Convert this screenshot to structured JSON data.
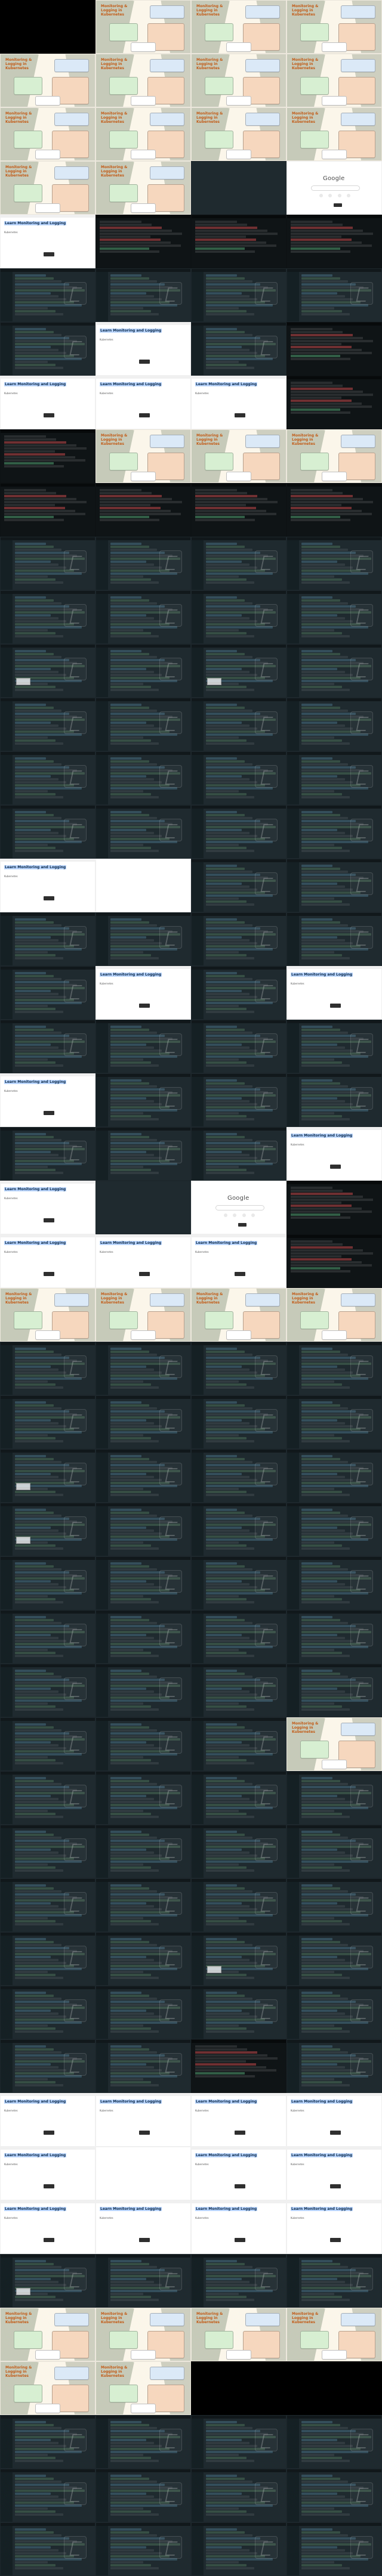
{
  "image": {
    "columns": 4,
    "rows": 48
  },
  "strings": {
    "slide_title": "Monitoring & Logging in Kubernetes",
    "web_heading": "Learn Monitoring and Logging",
    "web_sub": "Kubernetes",
    "google_logo": "Google"
  },
  "tiles": [
    {
      "kind": "blank-black"
    },
    {
      "kind": "slide"
    },
    {
      "kind": "slide"
    },
    {
      "kind": "slide"
    },
    {
      "kind": "slide"
    },
    {
      "kind": "slide"
    },
    {
      "kind": "slide"
    },
    {
      "kind": "slide"
    },
    {
      "kind": "slide"
    },
    {
      "kind": "slide"
    },
    {
      "kind": "slide"
    },
    {
      "kind": "slide"
    },
    {
      "kind": "slide"
    },
    {
      "kind": "slide"
    },
    {
      "kind": "blank-dark"
    },
    {
      "kind": "google"
    },
    {
      "kind": "web"
    },
    {
      "kind": "terminal",
      "variant": "error"
    },
    {
      "kind": "terminal",
      "variant": "error"
    },
    {
      "kind": "terminal",
      "variant": "error"
    },
    {
      "kind": "editor"
    },
    {
      "kind": "editor"
    },
    {
      "kind": "editor"
    },
    {
      "kind": "editor"
    },
    {
      "kind": "editor"
    },
    {
      "kind": "web"
    },
    {
      "kind": "editor"
    },
    {
      "kind": "terminal",
      "variant": "mixed"
    },
    {
      "kind": "web"
    },
    {
      "kind": "web"
    },
    {
      "kind": "web"
    },
    {
      "kind": "terminal",
      "variant": "mixed"
    },
    {
      "kind": "terminal",
      "variant": "mixed"
    },
    {
      "kind": "slide"
    },
    {
      "kind": "slide"
    },
    {
      "kind": "slide"
    },
    {
      "kind": "terminal",
      "variant": "mixed"
    },
    {
      "kind": "terminal",
      "variant": "mixed"
    },
    {
      "kind": "terminal",
      "variant": "mixed"
    },
    {
      "kind": "terminal",
      "variant": "mixed"
    },
    {
      "kind": "editor"
    },
    {
      "kind": "editor"
    },
    {
      "kind": "editor"
    },
    {
      "kind": "editor"
    },
    {
      "kind": "editor"
    },
    {
      "kind": "editor"
    },
    {
      "kind": "editor"
    },
    {
      "kind": "editor"
    },
    {
      "kind": "editor",
      "overlay": true
    },
    {
      "kind": "editor"
    },
    {
      "kind": "editor",
      "overlay": true
    },
    {
      "kind": "editor"
    },
    {
      "kind": "editor"
    },
    {
      "kind": "editor"
    },
    {
      "kind": "editor"
    },
    {
      "kind": "editor"
    },
    {
      "kind": "editor"
    },
    {
      "kind": "editor"
    },
    {
      "kind": "editor"
    },
    {
      "kind": "editor"
    },
    {
      "kind": "editor"
    },
    {
      "kind": "editor"
    },
    {
      "kind": "editor"
    },
    {
      "kind": "editor"
    },
    {
      "kind": "web"
    },
    {
      "kind": "blank-white"
    },
    {
      "kind": "editor"
    },
    {
      "kind": "editor"
    },
    {
      "kind": "editor"
    },
    {
      "kind": "editor"
    },
    {
      "kind": "editor"
    },
    {
      "kind": "editor"
    },
    {
      "kind": "editor"
    },
    {
      "kind": "web"
    },
    {
      "kind": "editor"
    },
    {
      "kind": "web"
    },
    {
      "kind": "editor"
    },
    {
      "kind": "editor"
    },
    {
      "kind": "editor"
    },
    {
      "kind": "editor"
    },
    {
      "kind": "web"
    },
    {
      "kind": "editor"
    },
    {
      "kind": "editor"
    },
    {
      "kind": "editor"
    },
    {
      "kind": "editor"
    },
    {
      "kind": "editor"
    },
    {
      "kind": "editor"
    },
    {
      "kind": "web"
    },
    {
      "kind": "web"
    },
    {
      "kind": "blank-dark"
    },
    {
      "kind": "google"
    },
    {
      "kind": "terminal",
      "variant": "mixed"
    },
    {
      "kind": "web"
    },
    {
      "kind": "web"
    },
    {
      "kind": "web"
    },
    {
      "kind": "terminal",
      "variant": "mixed"
    },
    {
      "kind": "slide"
    },
    {
      "kind": "slide"
    },
    {
      "kind": "slide"
    },
    {
      "kind": "slide"
    },
    {
      "kind": "editor"
    },
    {
      "kind": "editor"
    },
    {
      "kind": "editor"
    },
    {
      "kind": "editor"
    },
    {
      "kind": "editor"
    },
    {
      "kind": "editor"
    },
    {
      "kind": "editor"
    },
    {
      "kind": "editor"
    },
    {
      "kind": "editor",
      "overlay": true
    },
    {
      "kind": "editor"
    },
    {
      "kind": "editor"
    },
    {
      "kind": "editor"
    },
    {
      "kind": "editor",
      "overlay": true
    },
    {
      "kind": "editor"
    },
    {
      "kind": "editor"
    },
    {
      "kind": "editor"
    },
    {
      "kind": "editor"
    },
    {
      "kind": "editor"
    },
    {
      "kind": "editor"
    },
    {
      "kind": "editor"
    },
    {
      "kind": "editor"
    },
    {
      "kind": "editor"
    },
    {
      "kind": "editor"
    },
    {
      "kind": "editor"
    },
    {
      "kind": "editor"
    },
    {
      "kind": "editor"
    },
    {
      "kind": "editor"
    },
    {
      "kind": "editor"
    },
    {
      "kind": "editor"
    },
    {
      "kind": "editor"
    },
    {
      "kind": "editor"
    },
    {
      "kind": "slide"
    },
    {
      "kind": "editor"
    },
    {
      "kind": "editor"
    },
    {
      "kind": "editor"
    },
    {
      "kind": "editor"
    },
    {
      "kind": "editor"
    },
    {
      "kind": "editor"
    },
    {
      "kind": "editor"
    },
    {
      "kind": "editor"
    },
    {
      "kind": "editor"
    },
    {
      "kind": "editor"
    },
    {
      "kind": "editor"
    },
    {
      "kind": "editor"
    },
    {
      "kind": "editor"
    },
    {
      "kind": "editor"
    },
    {
      "kind": "editor",
      "overlay": true
    },
    {
      "kind": "editor"
    },
    {
      "kind": "editor"
    },
    {
      "kind": "editor"
    },
    {
      "kind": "editor"
    },
    {
      "kind": "editor"
    },
    {
      "kind": "editor"
    },
    {
      "kind": "editor"
    },
    {
      "kind": "terminal",
      "variant": "mixed"
    },
    {
      "kind": "editor"
    },
    {
      "kind": "web"
    },
    {
      "kind": "web"
    },
    {
      "kind": "web"
    },
    {
      "kind": "web"
    },
    {
      "kind": "web"
    },
    {
      "kind": "blank-white"
    },
    {
      "kind": "web"
    },
    {
      "kind": "web"
    },
    {
      "kind": "web"
    },
    {
      "kind": "web"
    },
    {
      "kind": "web"
    },
    {
      "kind": "web"
    },
    {
      "kind": "editor",
      "overlay": true
    },
    {
      "kind": "editor"
    },
    {
      "kind": "editor"
    },
    {
      "kind": "editor"
    },
    {
      "kind": "slide"
    },
    {
      "kind": "slide"
    },
    {
      "kind": "slide"
    },
    {
      "kind": "slide"
    },
    {
      "kind": "slide"
    },
    {
      "kind": "slide"
    },
    {
      "kind": "blank-black"
    },
    {
      "kind": "blank-black"
    }
  ]
}
